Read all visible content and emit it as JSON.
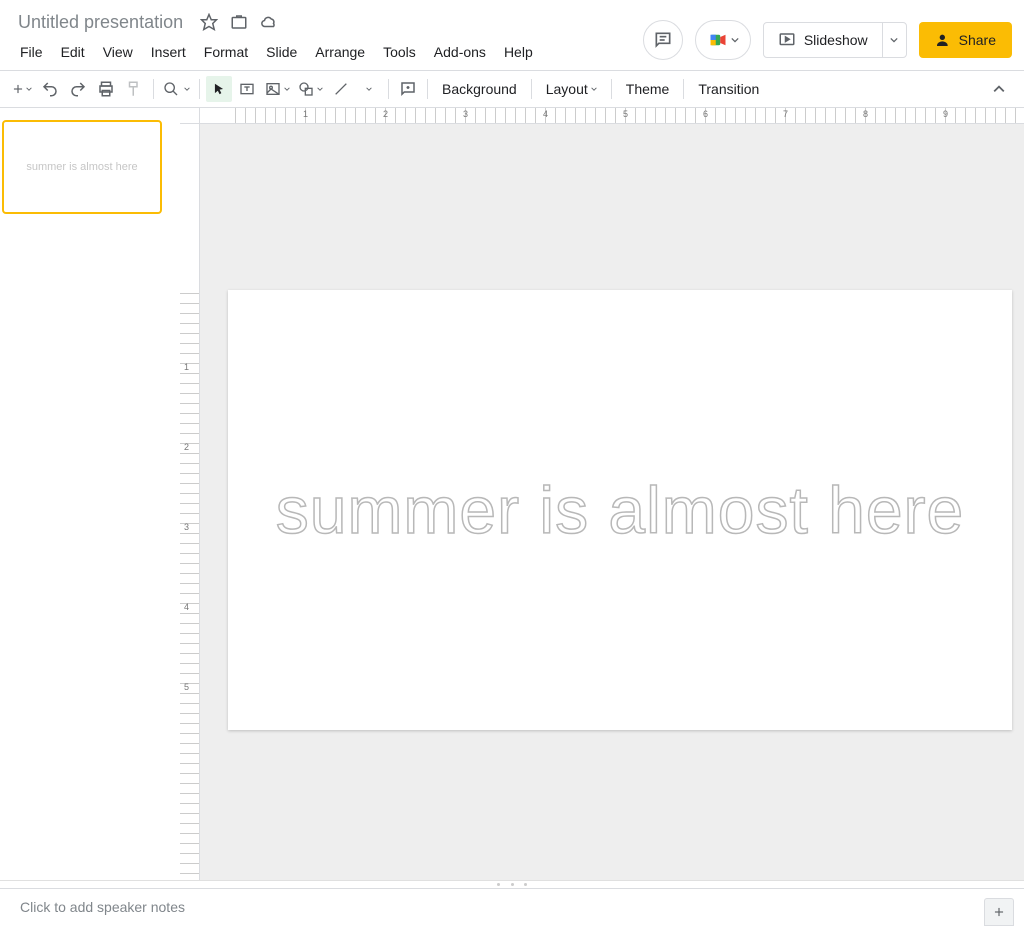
{
  "header": {
    "title": "Untitled presentation",
    "menus": [
      "File",
      "Edit",
      "View",
      "Insert",
      "Format",
      "Slide",
      "Arrange",
      "Tools",
      "Add-ons",
      "Help"
    ],
    "slideshow_label": "Slideshow",
    "share_label": "Share"
  },
  "toolbar": {
    "background": "Background",
    "layout": "Layout",
    "theme": "Theme",
    "transition": "Transition"
  },
  "ruler_h_numbers": [
    "1",
    "2",
    "3",
    "4",
    "5",
    "6",
    "7",
    "8",
    "9"
  ],
  "ruler_v_numbers": [
    "1",
    "2",
    "3",
    "4",
    "5"
  ],
  "slide": {
    "text": "summer is almost here",
    "thumb_text": "summer is almost here"
  },
  "notes": {
    "placeholder": "Click to add speaker notes"
  }
}
